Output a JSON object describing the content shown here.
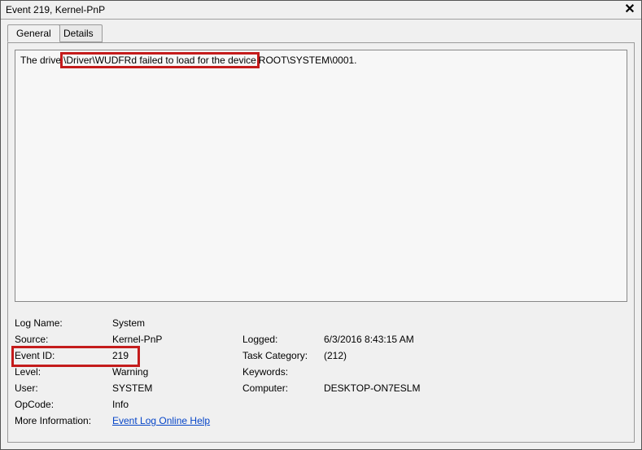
{
  "window": {
    "title": "Event 219, Kernel-PnP"
  },
  "tabs": {
    "general": "General",
    "details": "Details"
  },
  "message": {
    "prefix": "The drive",
    "highlight": " \\Driver\\WUDFRd failed to load for the device ",
    "suffix": "ROOT\\SYSTEM\\0001."
  },
  "fields": {
    "log_name_label": "Log Name:",
    "log_name_value": "System",
    "source_label": "Source:",
    "source_value": "Kernel-PnP",
    "logged_label": "Logged:",
    "logged_value": "6/3/2016 8:43:15 AM",
    "event_id_label": "Event ID:",
    "event_id_value": "219",
    "task_category_label": "Task Category:",
    "task_category_value": "(212)",
    "level_label": "Level:",
    "level_value": "Warning",
    "keywords_label": "Keywords:",
    "keywords_value": "",
    "user_label": "User:",
    "user_value": "SYSTEM",
    "computer_label": "Computer:",
    "computer_value": "DESKTOP-ON7ESLM",
    "opcode_label": "OpCode:",
    "opcode_value": "Info",
    "more_info_label": "More Information:",
    "more_info_link": "Event Log Online Help"
  }
}
